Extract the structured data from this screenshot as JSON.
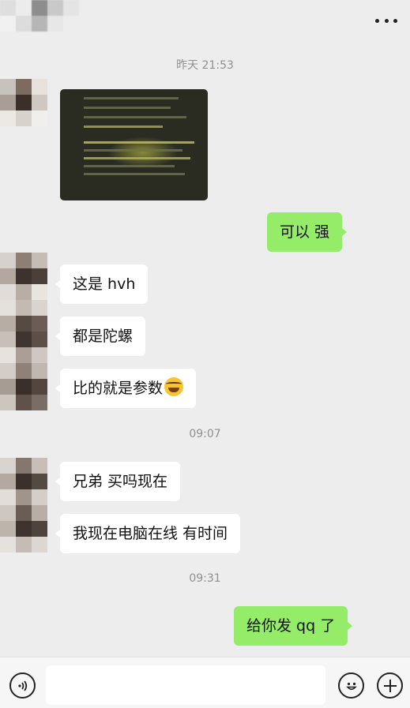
{
  "header": {
    "title_pixels": [
      "#d9d9d9",
      "#e9e9e9",
      "#8a8a8a",
      "#c7c7c7",
      "#e2e2e2",
      "#f0f0f0",
      "#dadada",
      "#b5b5b5",
      "#e6e6e6",
      "#ededed"
    ],
    "more_icon": "more-dots-icon"
  },
  "messages": {
    "time_1": "昨天 21:53",
    "time_2": "09:07",
    "time_3": "09:31",
    "self_1": "可以 强",
    "other_1": "这是 hvh",
    "other_2": "都是陀螺",
    "other_3": "比的就是参数",
    "other_4": "兄弟 买吗现在",
    "other_5": "我现在电脑在线 有时间",
    "self_2": "给你发 qq 了"
  },
  "emoji": {
    "name": "laugh-tears-emoji"
  },
  "input_bar": {
    "voice_icon": "voice-icon",
    "emoji_icon": "emoji-icon",
    "add_icon": "add-icon",
    "input_value": ""
  },
  "colors": {
    "background": "#ededed",
    "bubble_self": "#95ec69",
    "bubble_other": "#ffffff",
    "timestamp": "#8f8f8f"
  }
}
